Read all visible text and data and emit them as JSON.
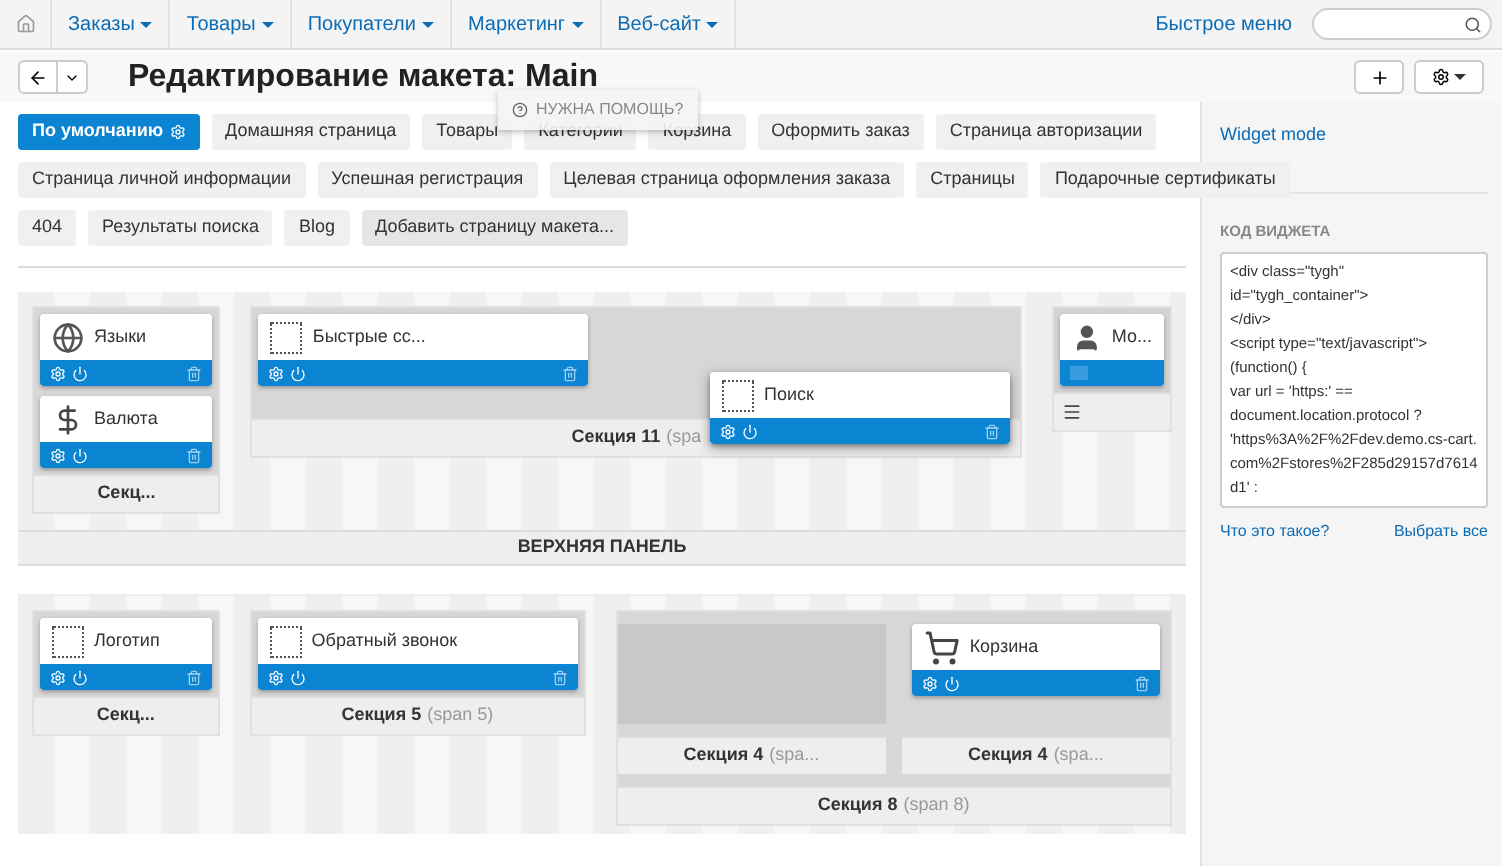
{
  "nav": {
    "items": [
      {
        "label": "Заказы"
      },
      {
        "label": "Товары"
      },
      {
        "label": "Покупатели"
      },
      {
        "label": "Маркетинг"
      },
      {
        "label": "Веб-сайт"
      }
    ],
    "quick_menu": "Быстрое меню"
  },
  "header": {
    "title": "Редактирование макета: Main"
  },
  "help_tooltip": "НУЖНА ПОМОЩЬ?",
  "tab_rows": [
    [
      {
        "label": "По умолчанию",
        "selected": true,
        "kind": "page"
      },
      {
        "label": "Домашняя страница",
        "selected": false,
        "kind": "page"
      },
      {
        "label": "Товары",
        "selected": false,
        "kind": "page"
      },
      {
        "label": "Категории",
        "selected": false,
        "kind": "page"
      },
      {
        "label": "Корзина",
        "selected": false,
        "kind": "page"
      },
      {
        "label": "Оформить заказ",
        "selected": false,
        "kind": "page"
      },
      {
        "label": "Страница авторизации",
        "selected": false,
        "kind": "page"
      }
    ],
    [
      {
        "label": "Страница личной информации",
        "selected": false,
        "kind": "page"
      },
      {
        "label": "Успешная регистрация",
        "selected": false,
        "kind": "page"
      },
      {
        "label": "Целевая страница оформления заказа",
        "selected": false,
        "kind": "page"
      },
      {
        "label": "Страницы",
        "selected": false,
        "kind": "page"
      },
      {
        "label": "Подарочные сертификаты",
        "selected": false,
        "kind": "page"
      }
    ],
    [
      {
        "label": "404",
        "selected": false,
        "kind": "page"
      },
      {
        "label": "Результаты поиска",
        "selected": false,
        "kind": "page"
      },
      {
        "label": "Blog",
        "selected": false,
        "kind": "page"
      },
      {
        "label": "Добавить страницу макета...",
        "selected": false,
        "kind": "add"
      }
    ]
  ],
  "containers": [
    {
      "sections": [
        {
          "name": "Секц...",
          "blocks": [
            {
              "name": "Языки",
              "kind": "globe"
            },
            {
              "name": "Валюта",
              "kind": "dollar"
            }
          ]
        },
        {
          "name": "Секция 11",
          "span": "(spa",
          "blocks": [
            {
              "name": "Быстрые сс...",
              "kind": "dashed"
            }
          ]
        },
        {
          "kind": "menu",
          "blocks": [
            {
              "name": "Мо...",
              "kind": "user",
              "compact": true
            }
          ]
        }
      ],
      "dragged_block": {
        "name": "Поиск",
        "kind": "dashed"
      },
      "footer": "ВЕРХНЯЯ ПАНЕЛЬ"
    },
    {
      "sections": [
        {
          "name": "Секц...",
          "blocks": [
            {
              "name": "Логотип",
              "kind": "dashed"
            }
          ]
        },
        {
          "name": "Секция 5",
          "span": "(span 5)",
          "blocks": [
            {
              "name": "Обратный звонок",
              "kind": "dashed"
            }
          ]
        },
        {
          "name": "Секция 8",
          "span": "(span 8)",
          "children": [
            {
              "name": "Секция 4",
              "span": "(spa..."
            },
            {
              "name": "Секция 4",
              "span": "(spa...",
              "blocks": [
                {
                  "name": "Корзина",
                  "kind": "cart"
                }
              ]
            }
          ]
        }
      ]
    }
  ],
  "sidebar": {
    "widget_mode": "Widget mode",
    "code_label": "КОД ВИДЖЕТА",
    "code": "<div class=\"tygh\"\nid=\"tygh_container\">\n</div>\n<script type=\"text/javascript\">\n(function() {\nvar url = 'https:' ==\ndocument.location.protocol ?\n'https%3A%2F%2Fdev.demo.cs-cart.com%2Fstores%2F285d29157d7614d1' :",
    "what_link": "Что это такое?",
    "select_all": "Выбрать все"
  }
}
